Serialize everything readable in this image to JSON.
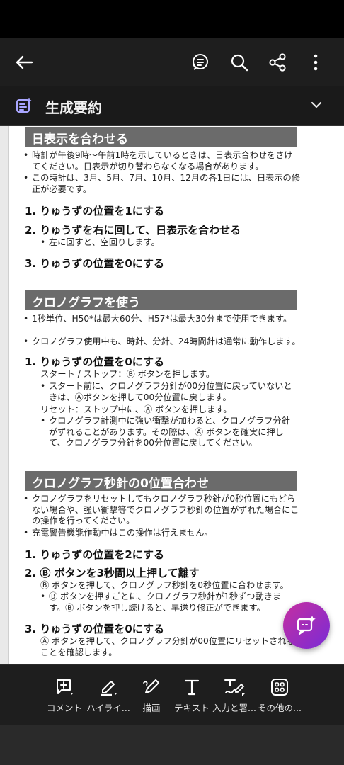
{
  "summary": {
    "label": "生成要約"
  },
  "document": {
    "sec1": {
      "heading": "日表示を合わせる",
      "bullets": [
        "時計が午後9時〜午前1時を示しているときは、日表示合わせをさけてください。日表示が切り替わらなくなる場合があります。",
        "この時計は、3月、5月、7月、10月、12月の各1日には、日表示の修正が必要です。"
      ],
      "step1": "1. りゅうずの位置を1にする",
      "step2": "2. りゅうずを右に回して、日表示を合わせる",
      "step2_note": "左に回すと、空回りします。",
      "step3": "3. りゅうずの位置を0にする"
    },
    "sec2": {
      "heading": "クロノグラフを使う",
      "bullets": [
        "1秒単位、H50*は最大60分、H57*は最大30分まで使用できます。",
        "クロノグラフ使用中も、時針、分針、24時間針は通常に動作します。"
      ],
      "step1": "1. りゅうずの位置を0にする",
      "start_stop": "スタート / ストップ：Ⓑ ボタンを押します。",
      "note1": "スタート前に、クロノグラフ分針が00分位置に戻っていないときは、Ⓐボタンを押して00分位置に戻します。",
      "reset": "リセット：ストップ中に、Ⓐ ボタンを押します。",
      "note2": "クロノグラフ計測中に強い衝撃が加わると、クロノグラフ分針がずれることがあります。その際は、Ⓐ ボタンを確実に押して、クロノグラフ分針を00分位置に戻してください。"
    },
    "sec3": {
      "heading": "クロノグラフ秒針の0位置合わせ",
      "bullets": [
        "クロノグラフをリセットしてもクロノグラフ秒針が0秒位置にもどらない場合や、強い衝撃等でクロノグラフ秒針の位置がずれた場合にこの操作を行ってください。",
        "充電警告機能作動中はこの操作は行えません。"
      ],
      "step1": "1. りゅうずの位置を2にする",
      "step2": "2. Ⓑ ボタンを3秒間以上押して離す",
      "step2_line": "Ⓑ ボタンを押して、クロノグラフ秒針を0秒位置に合わせます。",
      "step2_note": "Ⓑ ボタンを押すごとに、クロノグラフ秒針が1秒ずつ動きます。Ⓑ ボタンを押し続けると、早送り修正ができます。",
      "step3": "3. りゅうずの位置を0にする",
      "step3_line": "Ⓐ ボタンを押して、クロノグラフ分針が00位置にリセットされることを確認します。"
    }
  },
  "bottom_tools": [
    {
      "label": "コメント",
      "icon": "comment-add-icon"
    },
    {
      "label": "ハイライ...",
      "icon": "highlighter-icon"
    },
    {
      "label": "描画",
      "icon": "pen-draw-icon"
    },
    {
      "label": "テキスト",
      "icon": "text-icon"
    },
    {
      "label": "入力と署...",
      "icon": "fill-sign-icon"
    },
    {
      "label": "その他の...",
      "icon": "grid-more-icon"
    }
  ],
  "colors": {
    "header_bg": "#1e1e1e",
    "section_head": "#6b6b6b",
    "fab_start": "#c52fa0",
    "fab_end": "#7a2bd6",
    "summary_icon": "#a9a6ff"
  }
}
